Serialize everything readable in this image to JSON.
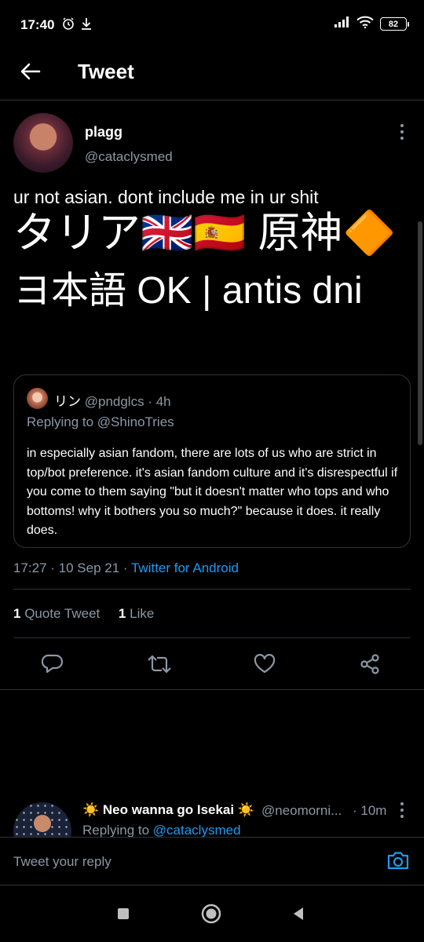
{
  "status_bar": {
    "time": "17:40",
    "battery": "82",
    "icons": [
      "alarm-icon",
      "download-icon",
      "signal-icon",
      "wifi-icon",
      "battery-icon"
    ]
  },
  "header": {
    "title": "Tweet",
    "back_icon": "arrow-left-icon"
  },
  "tweet": {
    "author_name": "plagg",
    "author_handle": "@cataclysmed",
    "text": "ur not asian. dont include me in ur shit",
    "media_text_line1": "タリア🇬🇧🇪🇸 原神🔶",
    "media_text_line2": "ヨ本語 OK | antis dni",
    "quote": {
      "name": "リン",
      "handle": "@pndglcs",
      "time": "· 4h",
      "replying_prefix": "Replying to ",
      "replying_to": "@ShinoTries",
      "text": "in especially asian fandom, there are lots of us who are strict in top/bot preference. it's asian fandom culture and it's disrespectful if you come to them saying \"but it doesn't matter who tops and who bottoms! why it bothers you so much?\" because it does. it really does."
    },
    "timestamp": "17:27 · 10 Sep 21 · ",
    "source": "Twitter for Android",
    "stats": {
      "quote_count": "1",
      "quote_label": "Quote Tweet",
      "like_count": "1",
      "like_label": "Like"
    },
    "actions": [
      "reply-icon",
      "retweet-icon",
      "like-icon",
      "share-icon"
    ]
  },
  "reply": {
    "name": "☀️ Neo wanna go Isekai ☀️",
    "handle": "@neomorni...",
    "time": "· 10m",
    "replying_prefix": "Replying to ",
    "replying_to": "@cataclysmed"
  },
  "composer": {
    "placeholder": "Tweet your reply",
    "camera_icon": "camera-icon"
  },
  "nav_bar": [
    "recents-square-icon",
    "home-circle-icon",
    "back-triangle-icon"
  ],
  "colors": {
    "background": "#000000",
    "text": "#ffffff",
    "secondary_text": "#8b98a5",
    "accent": "#1d9bf0",
    "border": "#2f3336"
  }
}
